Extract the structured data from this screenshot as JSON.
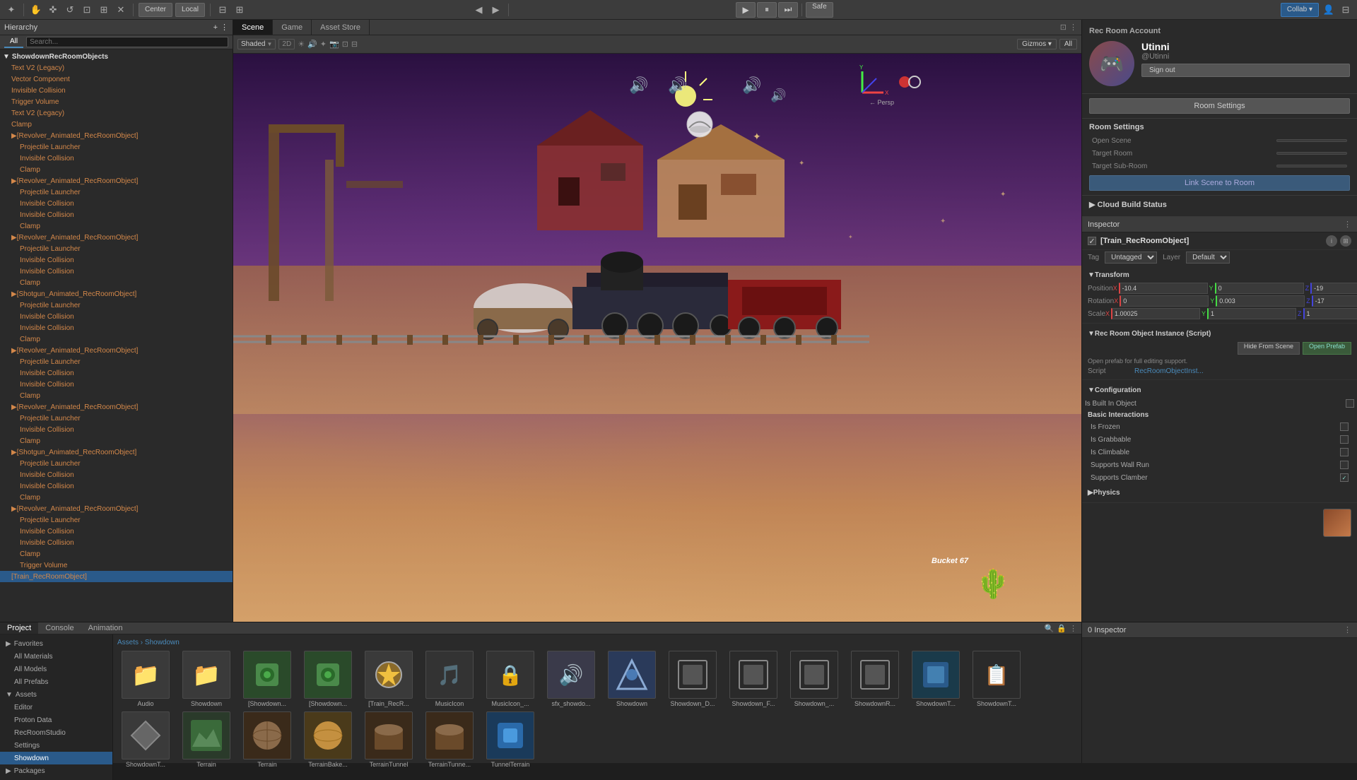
{
  "topToolbar": {
    "tools": [
      "✦",
      "◫",
      "⊕",
      "⊞",
      "↺",
      "⊡",
      "✕"
    ],
    "pivotLabel": "Center",
    "spaceLabel": "Local",
    "playBtn": "▶",
    "pauseBtn": "⏸",
    "stepBtn": "⏭",
    "safeLabel": "Safe",
    "collabLabel": "Collab ▾",
    "accountBtn": "▾"
  },
  "hierarchy": {
    "title": "Hierarchy",
    "searchPlaceholder": "Search...",
    "allLabel": "All",
    "items": [
      {
        "label": "ShowdownRecRoomObjects",
        "level": 0,
        "type": "root"
      },
      {
        "label": "Text V2 (Legacy)",
        "level": 1,
        "type": "orange"
      },
      {
        "label": "Vector Component",
        "level": 1,
        "type": "orange"
      },
      {
        "label": "Invisible Collision",
        "level": 1,
        "type": "orange"
      },
      {
        "label": "Trigger Volume",
        "level": 1,
        "type": "orange"
      },
      {
        "label": "Text V2 (Legacy)",
        "level": 1,
        "type": "orange"
      },
      {
        "label": "Clamp",
        "level": 1,
        "type": "orange"
      },
      {
        "label": "[Revolver_Animated_RecRoomObject]",
        "level": 1,
        "type": "orange"
      },
      {
        "label": "Projectile Launcher",
        "level": 2,
        "type": "orange"
      },
      {
        "label": "Invisible Collision",
        "level": 2,
        "type": "orange"
      },
      {
        "label": "Clamp",
        "level": 2,
        "type": "orange"
      },
      {
        "label": "[Revolver_Animated_RecRoomObject]",
        "level": 1,
        "type": "orange"
      },
      {
        "label": "Projectile Launcher",
        "level": 2,
        "type": "orange"
      },
      {
        "label": "Invisible Collision",
        "level": 2,
        "type": "orange"
      },
      {
        "label": "Invisible Collision",
        "level": 2,
        "type": "orange"
      },
      {
        "label": "Clamp",
        "level": 2,
        "type": "orange"
      },
      {
        "label": "[Revolver_Animated_RecRoomObject]",
        "level": 1,
        "type": "orange"
      },
      {
        "label": "Projectile Launcher",
        "level": 2,
        "type": "orange"
      },
      {
        "label": "Invisible Collision",
        "level": 2,
        "type": "orange"
      },
      {
        "label": "Invisible Collision",
        "level": 2,
        "type": "orange"
      },
      {
        "label": "Clamp",
        "level": 2,
        "type": "orange"
      },
      {
        "label": "[Shotgun_Animated_RecRoomObject]",
        "level": 1,
        "type": "orange"
      },
      {
        "label": "Projectile Launcher",
        "level": 2,
        "type": "orange"
      },
      {
        "label": "Invisible Collision",
        "level": 2,
        "type": "orange"
      },
      {
        "label": "Invisible Collision",
        "level": 2,
        "type": "orange"
      },
      {
        "label": "Clamp",
        "level": 2,
        "type": "orange"
      },
      {
        "label": "[Revolver_Animated_RecRoomObject]",
        "level": 1,
        "type": "orange"
      },
      {
        "label": "Projectile Launcher",
        "level": 2,
        "type": "orange"
      },
      {
        "label": "Invisible Collision",
        "level": 2,
        "type": "orange"
      },
      {
        "label": "Invisible Collision",
        "level": 2,
        "type": "orange"
      },
      {
        "label": "Clamp",
        "level": 2,
        "type": "orange"
      },
      {
        "label": "[Revolver_Animated_RecRoomObject]",
        "level": 1,
        "type": "orange"
      },
      {
        "label": "Projectile Launcher",
        "level": 2,
        "type": "orange"
      },
      {
        "label": "Invisible Collision",
        "level": 2,
        "type": "orange"
      },
      {
        "label": "Clamp",
        "level": 2,
        "type": "orange"
      },
      {
        "label": "[Shotgun_Animated_RecRoomObject]",
        "level": 1,
        "type": "orange"
      },
      {
        "label": "Projectile Launcher",
        "level": 2,
        "type": "orange"
      },
      {
        "label": "Invisible Collision",
        "level": 2,
        "type": "orange"
      },
      {
        "label": "Invisible Collision",
        "level": 2,
        "type": "orange"
      },
      {
        "label": "Clamp",
        "level": 2,
        "type": "orange"
      },
      {
        "label": "[Revolver_Animated_RecRoomObject]",
        "level": 1,
        "type": "orange"
      },
      {
        "label": "Projectile Launcher",
        "level": 2,
        "type": "orange"
      },
      {
        "label": "Invisible Collision",
        "level": 2,
        "type": "orange"
      },
      {
        "label": "Invisible Collision",
        "level": 2,
        "type": "orange"
      },
      {
        "label": "Clamp",
        "level": 2,
        "type": "orange"
      },
      {
        "label": "Trigger Volume",
        "level": 2,
        "type": "orange"
      },
      {
        "label": "[Train_RecRoomObject]",
        "level": 1,
        "type": "orange"
      }
    ]
  },
  "sceneTabs": [
    "Scene",
    "Game",
    "Asset Store"
  ],
  "sceneToolbar": {
    "shadedLabel": "Shaded",
    "twoDLabel": "2D",
    "gizmosLabel": "Gizmos ▾",
    "allLabel": "All"
  },
  "recRoomAccount": {
    "panelTitle": "Rec Room Account",
    "avatarEmoji": "🎮",
    "username": "Utinni",
    "handle": "@Utinni",
    "signOutLabel": "Sign out"
  },
  "roomSettings": {
    "title": "Room Settings",
    "openScene": "Open Scene",
    "targetRoom": "Target Room",
    "targetSubRoom": "Target Sub-Room",
    "linkSceneBtnLabel": "Link Scene to Room"
  },
  "cloudBuild": {
    "title": "Cloud Build Status"
  },
  "inspector": {
    "title": "Inspector",
    "objectName": "[Train_RecRoomObject]",
    "tagLabel": "Tag",
    "tagValue": "Untagged",
    "layerLabel": "Layer",
    "layerValue": "Default",
    "transform": {
      "title": "Transform",
      "position": {
        "label": "Position",
        "x": "-10.4",
        "y": "0",
        "z": ""
      },
      "rotation": {
        "label": "Rotation",
        "x": "0",
        "y": "0.003",
        "z": ""
      },
      "scale": {
        "label": "Scale",
        "x": "1.00025",
        "y": "1",
        "z": ""
      }
    },
    "script": {
      "title": "Rec Room Object Instance (Script)",
      "hideFromSceneLabel": "Hide From Scene",
      "openPrefabLabel": "Open Prefab",
      "openPrefabText": "Open prefab for full editing support.",
      "scriptLabel": "Script",
      "scriptValue": "RecRoomObjectInst..."
    },
    "configuration": {
      "title": "Configuration",
      "isBuiltInObject": "Is Built In Object",
      "subsections": {
        "basicInteractions": {
          "title": "Basic Interactions",
          "isFrozen": "Is Frozen",
          "isGrabbable": "Is Grabbable",
          "isClimbable": "Is Climbable",
          "supportsWallRun": "Supports Wall Run",
          "supportsClamber": "Supports Clamber"
        }
      }
    },
    "physics": "Physics"
  },
  "bottomTabs": [
    "Project",
    "Console",
    "Animation"
  ],
  "project": {
    "breadcrumb": [
      "Assets",
      "Showdown"
    ],
    "sidebarItems": [
      {
        "label": "Favorites",
        "level": 0
      },
      {
        "label": "All Materials",
        "level": 1
      },
      {
        "label": "All Models",
        "level": 1
      },
      {
        "label": "All Prefabs",
        "level": 1
      },
      {
        "label": "Assets",
        "level": 0
      },
      {
        "label": "Editor",
        "level": 1
      },
      {
        "label": "Proton Data",
        "level": 1
      },
      {
        "label": "RecRoomStudio",
        "level": 1
      },
      {
        "label": "Settings",
        "level": 1
      },
      {
        "label": "Showdown",
        "level": 1,
        "selected": true
      },
      {
        "label": "Packages",
        "level": 0
      }
    ],
    "assets": [
      {
        "name": "Audio",
        "icon": "📁",
        "color": "#888"
      },
      {
        "name": "Showdown",
        "icon": "📁",
        "color": "#888"
      },
      {
        "name": "[Showdown...",
        "icon": "🟢",
        "color": "#4a4"
      },
      {
        "name": "[Showdown...",
        "icon": "🟢",
        "color": "#4a4"
      },
      {
        "name": "[Train_RecR...",
        "icon": "🎯",
        "color": "#888"
      },
      {
        "name": "MusicIcon",
        "icon": "🎵",
        "color": "#888"
      },
      {
        "name": "MusicIcon_...",
        "icon": "🔒",
        "color": "#888"
      },
      {
        "name": "sfx_showdo...",
        "icon": "🔊",
        "color": "#888"
      },
      {
        "name": "Showdown",
        "icon": "🔷",
        "color": "#888"
      },
      {
        "name": "Showdown_D...",
        "icon": "▢",
        "color": "#aaa"
      },
      {
        "name": "Showdown_F...",
        "icon": "▢",
        "color": "#aaa"
      },
      {
        "name": "Showdown_...",
        "icon": "▢",
        "color": "#aaa"
      },
      {
        "name": "ShowdownR...",
        "icon": "▢",
        "color": "#aaa"
      },
      {
        "name": "ShowdownT...",
        "icon": "🟦",
        "color": "#4af"
      },
      {
        "name": "ShowdownT...",
        "icon": "📋",
        "color": "#aaa"
      },
      {
        "name": "ShowdownT...",
        "icon": "◈",
        "color": "#888"
      },
      {
        "name": "Terrain",
        "icon": "▣",
        "color": "#4a8"
      },
      {
        "name": "Terrain",
        "icon": "🟤",
        "color": "#884"
      },
      {
        "name": "TerrainBake...",
        "icon": "🟡",
        "color": "#884"
      },
      {
        "name": "TerrainTunnel",
        "icon": "🟤",
        "color": "#664"
      },
      {
        "name": "TerrainTunne...",
        "icon": "🟤",
        "color": "#664"
      },
      {
        "name": "TunnelTerrain",
        "icon": "🔷",
        "color": "#4af"
      }
    ]
  },
  "inspectorBottomPanel": {
    "title": "0 Inspector",
    "objectCount": "0"
  }
}
